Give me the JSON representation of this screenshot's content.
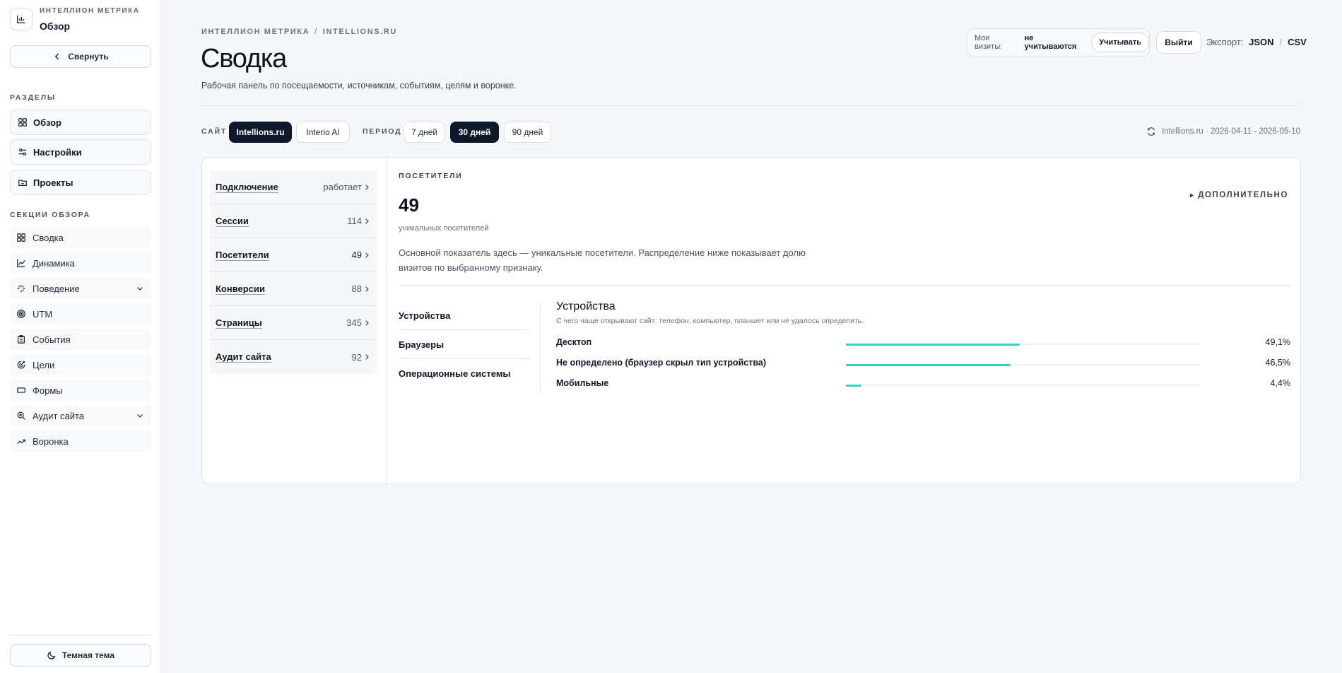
{
  "sidebar": {
    "brand_name": "ИНТЕЛЛИОН МЕТРИКА",
    "brand_page": "Обзор",
    "collapse_label": "Свернуть",
    "sections_title": "РАЗДЕЛЫ",
    "sections": [
      {
        "label": "Обзор",
        "icon": "grid-icon"
      },
      {
        "label": "Настройки",
        "icon": "sliders-icon"
      },
      {
        "label": "Проекты",
        "icon": "folder-icon"
      }
    ],
    "overview_title": "СЕКЦИИ ОБЗОРА",
    "overview_items": [
      {
        "label": "Сводка",
        "icon": "grid-icon"
      },
      {
        "label": "Динамика",
        "icon": "line-chart-icon"
      },
      {
        "label": "Поведение",
        "icon": "sparkle-icon",
        "expandable": true
      },
      {
        "label": "UTM",
        "icon": "target-icon"
      },
      {
        "label": "События",
        "icon": "clipboard-icon"
      },
      {
        "label": "Цели",
        "icon": "goal-icon"
      },
      {
        "label": "Формы",
        "icon": "form-icon"
      },
      {
        "label": "Аудит сайта",
        "icon": "search-icon",
        "expandable": true
      },
      {
        "label": "Воронка",
        "icon": "trend-icon"
      }
    ],
    "theme_label": "Темная тема"
  },
  "header": {
    "breadcrumb": [
      "ИНТЕЛЛИОН МЕТРИКА",
      "INTELLIONS.RU"
    ],
    "title": "Сводка",
    "subtitle": "Рабочая панель по посещаемости, источникам, событиям, целям и воронке.",
    "visits_label": "Мои визиты:",
    "visits_state": "не учитываются",
    "visits_button": "Учитывать",
    "logout": "Выйти",
    "export_label": "Экспорт:",
    "export_json": "JSON",
    "export_csv": "CSV"
  },
  "filters": {
    "site_label": "САЙТ",
    "sites": [
      {
        "label": "Intellions.ru",
        "active": true
      },
      {
        "label": "Interio AI",
        "active": false
      }
    ],
    "period_label": "ПЕРИОД",
    "periods": [
      {
        "label": "7 дней",
        "active": false
      },
      {
        "label": "30 дней",
        "active": true
      },
      {
        "label": "90 дней",
        "active": false
      }
    ],
    "range_text": "Intellions.ru · 2026-04-11 - 2026-05-10"
  },
  "metrics": [
    {
      "name": "Подключение",
      "value": "работает"
    },
    {
      "name": "Сессии",
      "value": "114"
    },
    {
      "name": "Посетители",
      "value": "49"
    },
    {
      "name": "Конверсии",
      "value": "88"
    },
    {
      "name": "Страницы",
      "value": "345"
    },
    {
      "name": "Аудит сайта",
      "value": "92"
    }
  ],
  "detail": {
    "eyebrow": "ПОСЕТИТЕЛИ",
    "value": "49",
    "unit": "уникальных посетителей",
    "more": "ДОПОЛНИТЕЛЬНО",
    "description": "Основной показатель здесь — уникальные посетители. Распределение ниже показывает долю визитов по выбранному признаку.",
    "dimension_tabs": [
      "Устройства",
      "Браузеры",
      "Операционные системы"
    ],
    "dimension_title": "Устройства",
    "dimension_subtitle": "С чего чаще открывают сайт: телефон, компьютер, планшет или не удалось определить.",
    "rows": [
      {
        "label": "Десктоп",
        "pct_text": "49,1%",
        "share": 0.491
      },
      {
        "label": "Не определено (браузер скрыл тип устройства)",
        "pct_text": "46,5%",
        "share": 0.465
      },
      {
        "label": "Мобильные",
        "pct_text": "4,4%",
        "share": 0.044
      }
    ],
    "accent_color": "#3bcfc4"
  }
}
